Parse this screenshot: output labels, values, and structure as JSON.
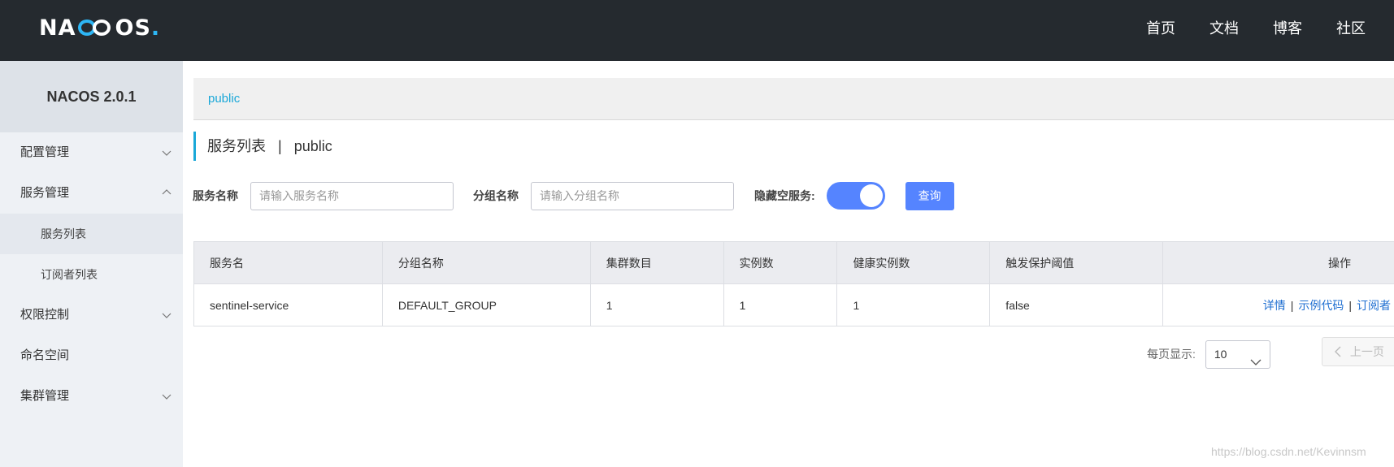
{
  "topbar": {
    "logo": {
      "pre": "NA",
      "post": "OS",
      "dot": "."
    },
    "nav": [
      "首页",
      "文档",
      "博客",
      "社区"
    ]
  },
  "sidebar": {
    "version": "NACOS 2.0.1",
    "items": [
      {
        "label": "配置管理",
        "icon": "chevron-down-icon"
      },
      {
        "label": "服务管理",
        "icon": "chevron-up-icon"
      },
      {
        "label": "服务列表"
      },
      {
        "label": "订阅者列表"
      },
      {
        "label": "权限控制",
        "icon": "chevron-down-icon"
      },
      {
        "label": "命名空间"
      },
      {
        "label": "集群管理",
        "icon": "chevron-down-icon"
      }
    ]
  },
  "main": {
    "namespace": "public",
    "title": "服务列表",
    "title_sep": "|",
    "title_ns": "public",
    "search": {
      "service_label": "服务名称",
      "service_placeholder": "请输入服务名称",
      "group_label": "分组名称",
      "group_placeholder": "请输入分组名称",
      "hide_empty_label": "隐藏空服务:",
      "hide_empty_on": true,
      "query_button": "查询"
    },
    "table": {
      "columns": [
        "服务名",
        "分组名称",
        "集群数目",
        "实例数",
        "健康实例数",
        "触发保护阈值",
        "操作"
      ],
      "rows": [
        [
          "sentinel-service",
          "DEFAULT_GROUP",
          "1",
          "1",
          "1",
          "false"
        ]
      ],
      "actions": [
        "详情",
        "示例代码",
        "订阅者"
      ],
      "action_sep": "|"
    },
    "pager": {
      "page_size_label": "每页显示:",
      "page_size": "10",
      "prev_label": "上一页"
    }
  },
  "watermark": "https://blog.csdn.net/Kevinnsm",
  "colors": {
    "topbar": "#252a2f",
    "accent": "#1aa8d8",
    "primary": "#5584ff",
    "link": "#1f6fd1"
  }
}
